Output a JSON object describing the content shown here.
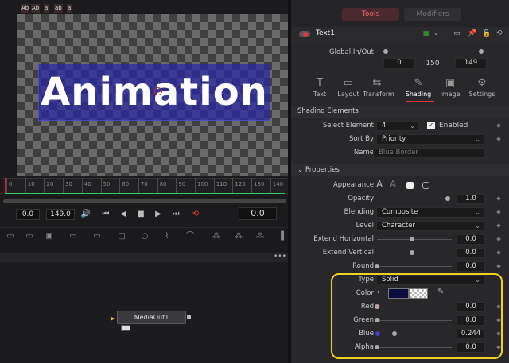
{
  "viewer": {
    "overlay_text": "Animation",
    "chips": [
      "Ab",
      "Ab",
      "a",
      "ab",
      "a"
    ]
  },
  "ruler": {
    "ticks": [
      "0",
      "10",
      "20",
      "30",
      "40",
      "50",
      "60",
      "70",
      "80",
      "90",
      "100",
      "110",
      "120",
      "130",
      "140"
    ]
  },
  "transport": {
    "start": "0.0",
    "end": "149.0",
    "current": "0.0"
  },
  "node": {
    "label": "MediaOut1"
  },
  "inspector": {
    "tabs": {
      "tools": "Tools",
      "modifiers": "Modifiers"
    },
    "tool_name": "Text1",
    "global_label": "Global In/Out",
    "global_in": "0",
    "global_mid": "150",
    "global_out": "149",
    "panel_tabs": [
      {
        "label": "Text",
        "icon": "T"
      },
      {
        "label": "Layout",
        "icon": "▭"
      },
      {
        "label": "Transform",
        "icon": "⇆"
      },
      {
        "label": "Shading",
        "icon": "✎"
      },
      {
        "label": "Image",
        "icon": "▣"
      },
      {
        "label": "Settings",
        "icon": "⚙"
      }
    ],
    "active_tab": "Shading",
    "shading_elements_title": "Shading Elements",
    "select_element_label": "Select Element",
    "select_element_value": "4",
    "enabled_label": "Enabled",
    "sort_by_label": "Sort By",
    "sort_by_value": "Priority",
    "name_label": "Name",
    "name_placeholder": "Blue Border",
    "properties_title": "Properties",
    "appearance_label": "Appearance",
    "opacity_label": "Opacity",
    "opacity_value": "1.0",
    "blending_label": "Blending",
    "blending_value": "Composite",
    "level_label": "Level",
    "level_value": "Character",
    "extend_h_label": "Extend Horizontal",
    "extend_h_value": "0.0",
    "extend_v_label": "Extend Vertical",
    "extend_v_value": "0.0",
    "round_label": "Round",
    "round_value": "0.0",
    "type_label": "Type",
    "type_value": "Solid",
    "color_label": "Color",
    "red_label": "Red",
    "red_value": "0.0",
    "green_label": "Green",
    "green_value": "0.0",
    "blue_label": "Blue",
    "blue_value": "0.244",
    "alpha_label": "Alpha",
    "alpha_value": "0.0"
  },
  "colors": {
    "swatch": "#0c0c3e",
    "highlight": "#f0d020",
    "red_dot": "#d02020",
    "green_dot": "#30a030",
    "blue_dot": "#4040c0"
  }
}
